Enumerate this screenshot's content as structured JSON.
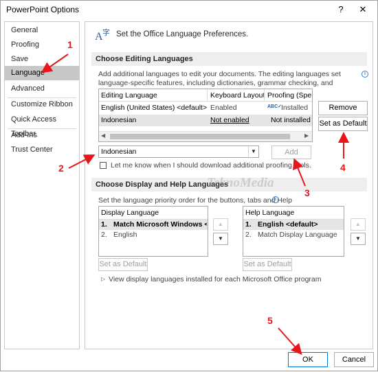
{
  "window": {
    "title": "PowerPoint Options",
    "help": "?",
    "close": "✕"
  },
  "sidebar": {
    "items": [
      "General",
      "Proofing",
      "Save",
      "Language",
      "Advanced",
      "Customize Ribbon",
      "Quick Access Toolbar",
      "Add-Ins",
      "Trust Center"
    ],
    "selected": "Language"
  },
  "header": {
    "text": "Set the Office Language Preferences."
  },
  "editing": {
    "section_title": "Choose Editing Languages",
    "description": "Add additional languages to edit your documents. The editing languages set language-specific features, including dictionaries, grammar checking, and sorting",
    "columns": [
      "Editing Language",
      "Keyboard Layout",
      "Proofing (Spelli"
    ],
    "rows": [
      {
        "lang": "English (United States) <default>",
        "kb": "Enabled",
        "proof": "Installed"
      },
      {
        "lang": "Indonesian",
        "kb": "Not enabled",
        "proof": "Not installed"
      }
    ],
    "remove_label": "Remove",
    "set_default_label": "Set as Default",
    "dropdown_value": "Indonesian",
    "add_label": "Add",
    "checkbox_label": "Let me know when I should download additional proofing tools."
  },
  "display": {
    "section_title": "Choose Display and Help Languages",
    "description": "Set the language priority order for the buttons, tabs and Help",
    "display_header": "Display Language",
    "display_items": [
      "Match Microsoft Windows <def",
      "English"
    ],
    "help_header": "Help Language",
    "help_items": [
      "English <default>",
      "Match Display Language"
    ],
    "set_default_label": "Set as Default",
    "view_link": "View display languages installed for each Microsoft Office program"
  },
  "footer": {
    "ok": "OK",
    "cancel": "Cancel"
  },
  "watermark": "TeknoMedia",
  "annotations": [
    "1",
    "2",
    "3",
    "4",
    "5"
  ],
  "colors": {
    "annotation": "#e8151b",
    "selected_item": "#c8c8c8",
    "section_bg": "#eeeeee",
    "accent": "#0078d7"
  }
}
